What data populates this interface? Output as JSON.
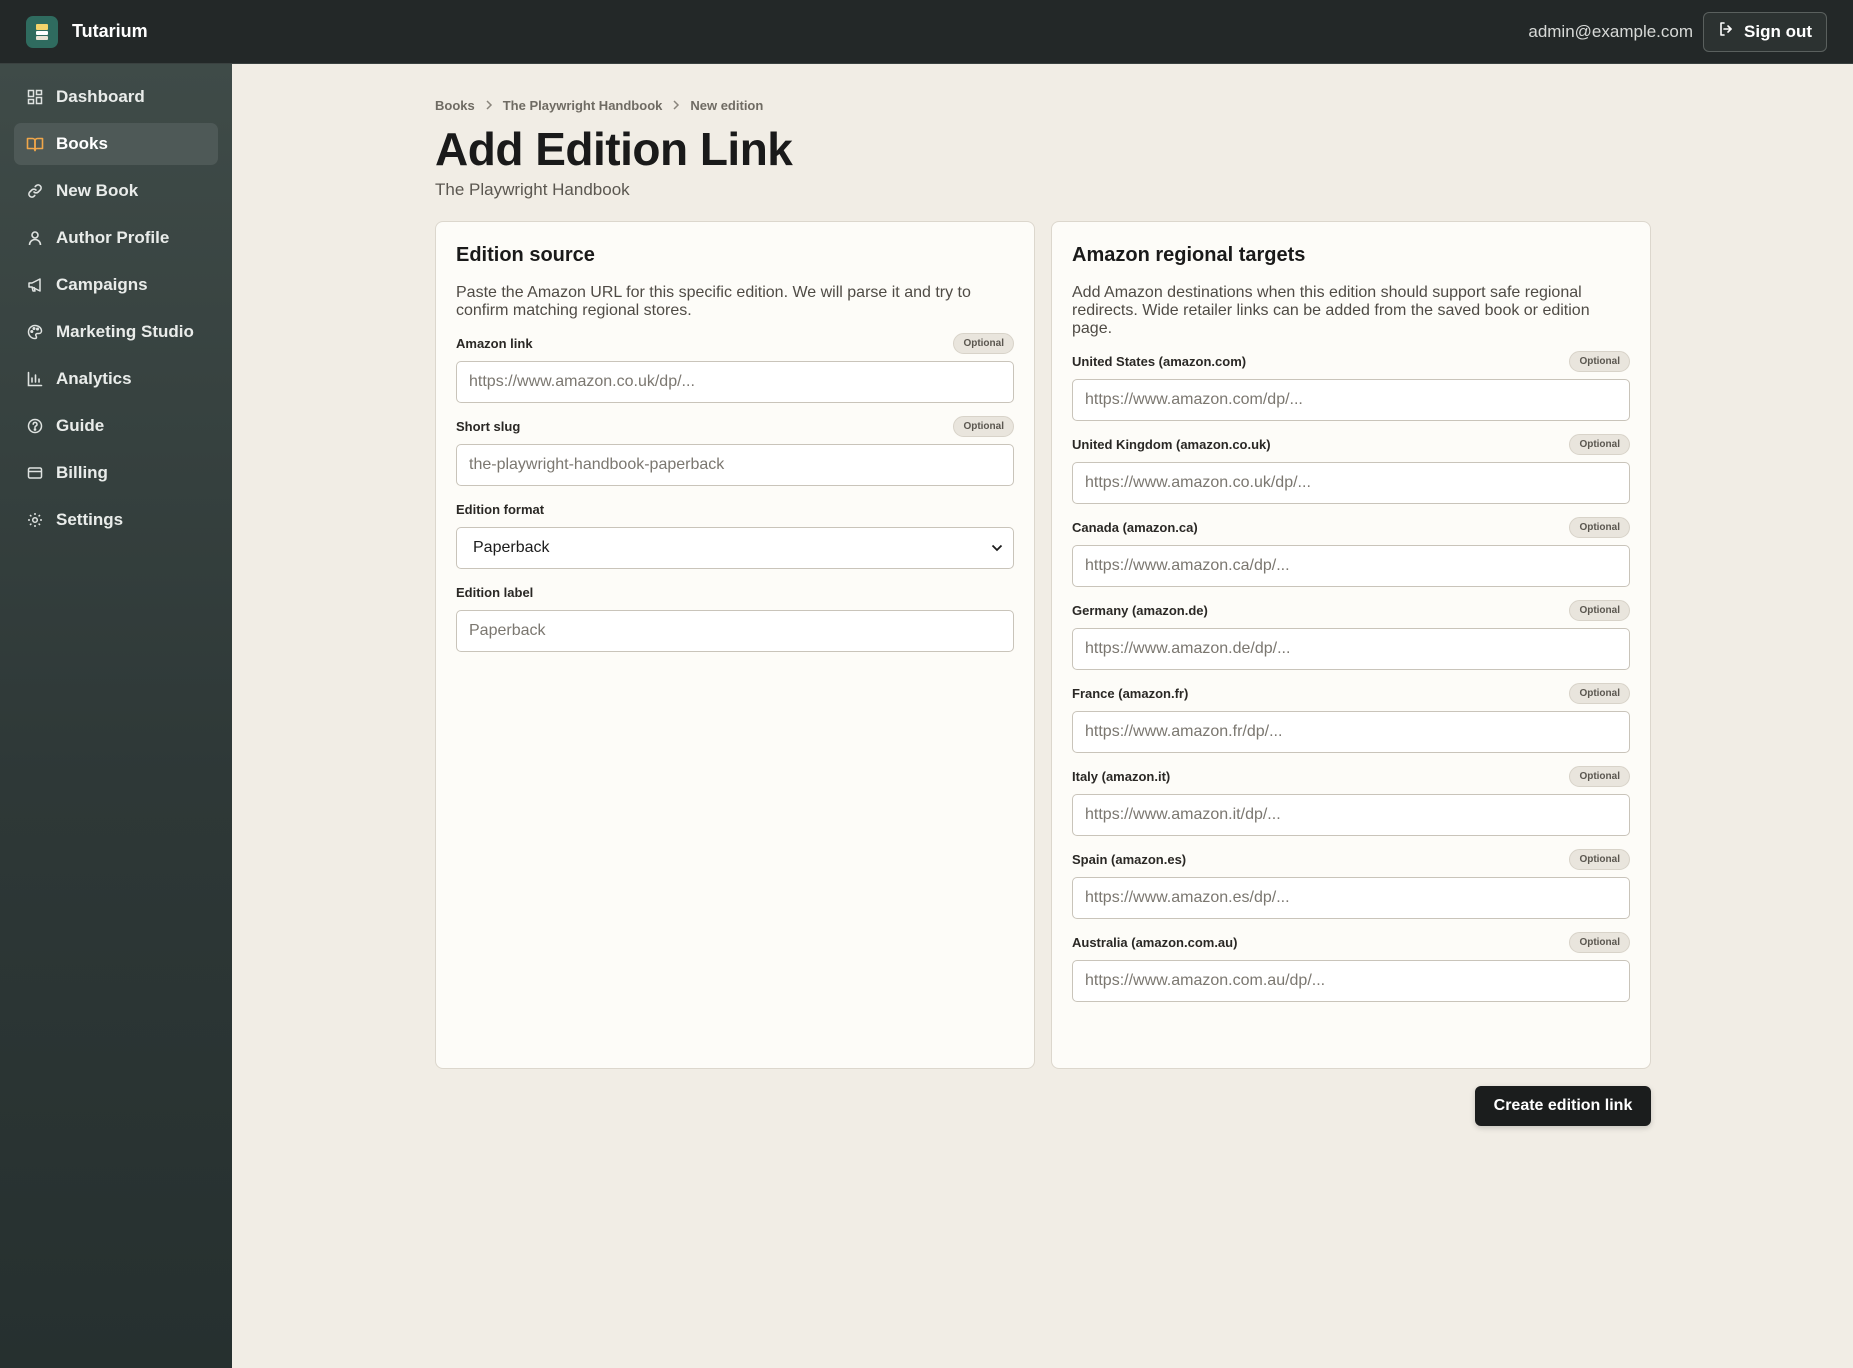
{
  "app": {
    "name": "Tutarium"
  },
  "user": {
    "email": "admin@example.com",
    "signout_label": "Sign out"
  },
  "sidebar": {
    "items": [
      {
        "label": "Dashboard",
        "icon": "dashboard-icon",
        "active": false
      },
      {
        "label": "Books",
        "icon": "book-icon",
        "active": true
      },
      {
        "label": "New Book",
        "icon": "link-icon",
        "active": false
      },
      {
        "label": "Author Profile",
        "icon": "user-icon",
        "active": false
      },
      {
        "label": "Campaigns",
        "icon": "megaphone-icon",
        "active": false
      },
      {
        "label": "Marketing Studio",
        "icon": "palette-icon",
        "active": false
      },
      {
        "label": "Analytics",
        "icon": "bar-chart-icon",
        "active": false
      },
      {
        "label": "Guide",
        "icon": "help-icon",
        "active": false
      },
      {
        "label": "Billing",
        "icon": "credit-card-icon",
        "active": false
      },
      {
        "label": "Settings",
        "icon": "gear-icon",
        "active": false
      }
    ]
  },
  "breadcrumb": [
    "Books",
    "The Playwright Handbook",
    "New edition"
  ],
  "page": {
    "title": "Add Edition Link",
    "subtitle": "The Playwright Handbook"
  },
  "edition_source": {
    "title": "Edition source",
    "description": "Paste the Amazon URL for this specific edition. We will parse it and try to confirm matching regional stores.",
    "amazon_link": {
      "label": "Amazon link",
      "badge": "Optional",
      "placeholder": "https://www.amazon.co.uk/dp/..."
    },
    "short_slug": {
      "label": "Short slug",
      "badge": "Optional",
      "placeholder": "the-playwright-handbook-paperback"
    },
    "edition_format": {
      "label": "Edition format",
      "value": "Paperback"
    },
    "edition_label": {
      "label": "Edition label",
      "placeholder": "Paperback"
    }
  },
  "regional_targets": {
    "title": "Amazon regional targets",
    "description": "Add Amazon destinations when this edition should support safe regional redirects. Wide retailer links can be added from the saved book or edition page.",
    "fields": [
      {
        "label": "United States (amazon.com)",
        "badge": "Optional",
        "placeholder": "https://www.amazon.com/dp/..."
      },
      {
        "label": "United Kingdom (amazon.co.uk)",
        "badge": "Optional",
        "placeholder": "https://www.amazon.co.uk/dp/..."
      },
      {
        "label": "Canada (amazon.ca)",
        "badge": "Optional",
        "placeholder": "https://www.amazon.ca/dp/..."
      },
      {
        "label": "Germany (amazon.de)",
        "badge": "Optional",
        "placeholder": "https://www.amazon.de/dp/..."
      },
      {
        "label": "France (amazon.fr)",
        "badge": "Optional",
        "placeholder": "https://www.amazon.fr/dp/..."
      },
      {
        "label": "Italy (amazon.it)",
        "badge": "Optional",
        "placeholder": "https://www.amazon.it/dp/..."
      },
      {
        "label": "Spain (amazon.es)",
        "badge": "Optional",
        "placeholder": "https://www.amazon.es/dp/..."
      },
      {
        "label": "Australia (amazon.com.au)",
        "badge": "Optional",
        "placeholder": "https://www.amazon.com.au/dp/..."
      }
    ]
  },
  "actions": {
    "create_label": "Create edition link"
  },
  "colors": {
    "topbar": "#232828",
    "accent": "#f0a64a",
    "brand": "#2f6b5f",
    "page_bg": "#f1ede5"
  }
}
